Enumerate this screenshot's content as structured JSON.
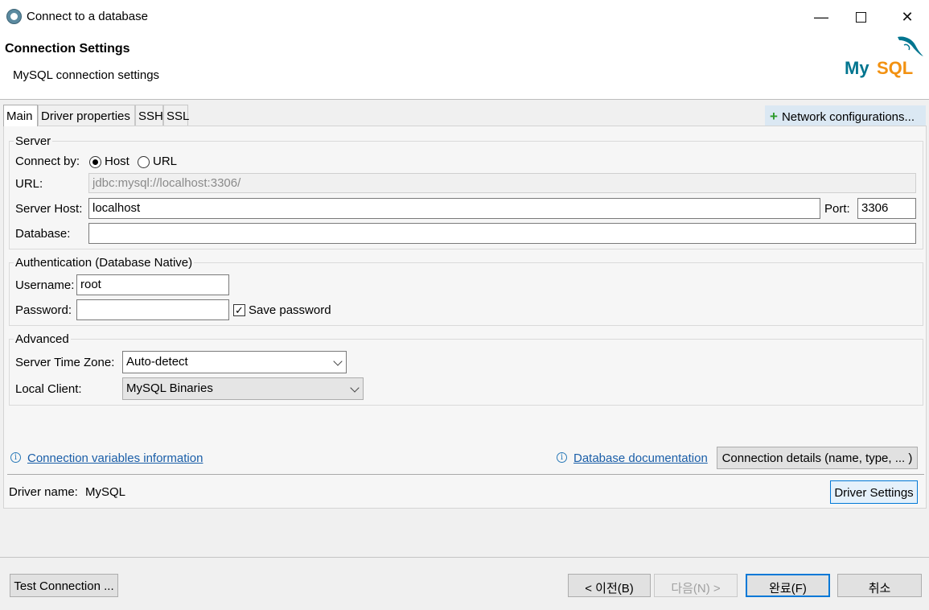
{
  "window": {
    "title": "Connect to a database",
    "controls": [
      "minimize",
      "maximize",
      "close"
    ]
  },
  "banner": {
    "title": "Connection Settings",
    "subtitle": "MySQL connection settings",
    "logo_text": "MySQL"
  },
  "tabs": [
    {
      "label": "Main",
      "active": true
    },
    {
      "label": "Driver properties",
      "active": false
    },
    {
      "label": "SSH",
      "active": false
    },
    {
      "label": "SSL",
      "active": false
    }
  ],
  "network_button": {
    "label": "Network configurations..."
  },
  "server": {
    "group_title": "Server",
    "connect_by_label": "Connect by:",
    "option_host": "Host",
    "option_url": "URL",
    "selected": "Host",
    "url_label": "URL:",
    "url_value": "jdbc:mysql://localhost:3306/",
    "host_label": "Server Host:",
    "host_value": "localhost",
    "port_label": "Port:",
    "port_value": "3306",
    "database_label": "Database:",
    "database_value": ""
  },
  "auth": {
    "group_title": "Authentication (Database Native)",
    "username_label": "Username:",
    "username_value": "root",
    "password_label": "Password:",
    "password_value": "",
    "save_password_label": "Save password",
    "save_password_checked": true
  },
  "advanced": {
    "group_title": "Advanced",
    "timezone_label": "Server Time Zone:",
    "timezone_value": "Auto-detect",
    "client_label": "Local Client:",
    "client_value": "MySQL Binaries"
  },
  "links": {
    "conn_vars": "Connection variables information",
    "db_docs": "Database documentation",
    "conn_details": "Connection details (name, type, ... )"
  },
  "driver": {
    "label": "Driver name:",
    "value": "MySQL",
    "settings_button": "Driver Settings"
  },
  "footer": {
    "test_connection": "Test Connection ...",
    "back": "< 이전(B)",
    "next": "다음(N) >",
    "finish": "완료(F)",
    "cancel": "취소"
  },
  "colors": {
    "link": "#1a5ea8",
    "accent": "#0078d7",
    "logo_blue": "#00758f",
    "logo_orange": "#f29111"
  }
}
